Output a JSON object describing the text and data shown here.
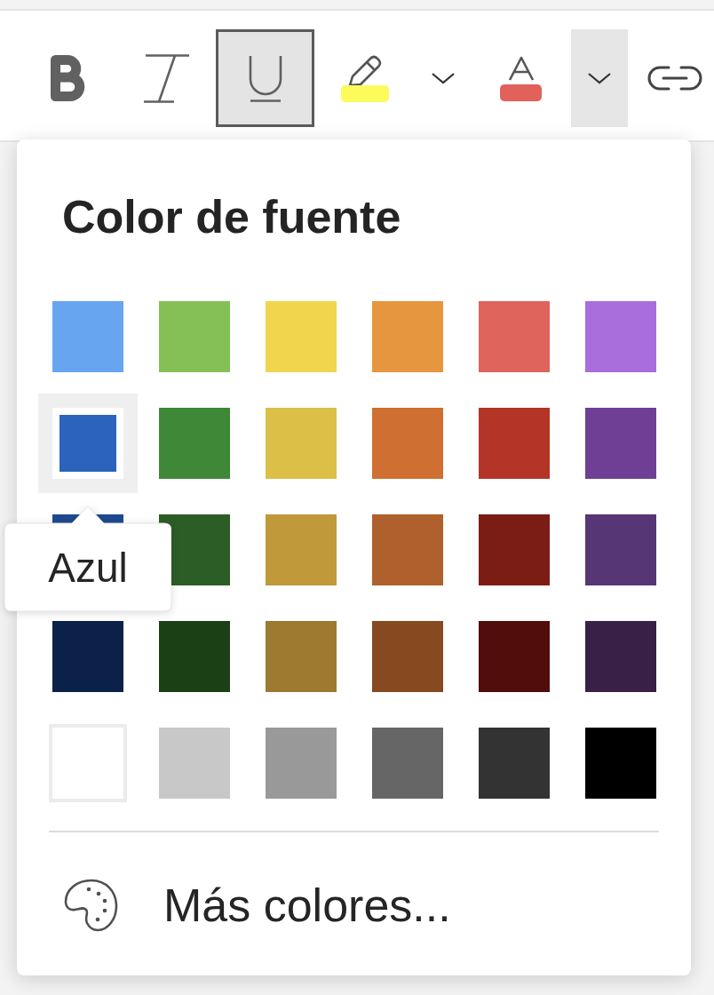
{
  "toolbar": {
    "format_buttons": [
      {
        "kind": "bold",
        "on": false
      },
      {
        "kind": "italic",
        "on": false
      },
      {
        "kind": "underline",
        "on": true
      }
    ],
    "color_buttons": [
      {
        "kind": "highlight",
        "color": "#fbfb5c",
        "menu_expanded": false
      },
      {
        "kind": "font-color",
        "color": "#e0625a",
        "menu_expanded": true
      }
    ]
  },
  "font_color_menu": {
    "title": "Color de fuente",
    "swatch_rows": [
      [
        {
          "color": "#68a5f1",
          "selected": false
        },
        {
          "color": "#85c057",
          "selected": false
        },
        {
          "color": "#f0d54d",
          "selected": false
        },
        {
          "color": "#e6963e",
          "selected": false
        },
        {
          "color": "#de645c",
          "selected": false
        },
        {
          "color": "#a96ddc",
          "selected": false
        }
      ],
      [
        {
          "color": "#2b63bd",
          "selected": true
        },
        {
          "color": "#3f8838",
          "selected": false
        },
        {
          "color": "#dbbf47",
          "selected": false
        },
        {
          "color": "#cf6f31",
          "selected": false
        },
        {
          "color": "#b43527",
          "selected": false
        },
        {
          "color": "#6f3f95",
          "selected": false
        }
      ],
      [
        {
          "color": "#1f4a8e",
          "selected": false
        },
        {
          "color": "#2d5d27",
          "selected": false
        },
        {
          "color": "#bf993a",
          "selected": false
        },
        {
          "color": "#af602c",
          "selected": false
        },
        {
          "color": "#7b1d15",
          "selected": false
        },
        {
          "color": "#573676",
          "selected": false
        }
      ],
      [
        {
          "color": "#0b214a",
          "selected": false
        },
        {
          "color": "#1c4016",
          "selected": false
        },
        {
          "color": "#9d7a30",
          "selected": false
        },
        {
          "color": "#864920",
          "selected": false
        },
        {
          "color": "#500d0b",
          "selected": false
        },
        {
          "color": "#392047",
          "selected": false
        }
      ],
      [
        {
          "color": "#ffffff",
          "selected": false
        },
        {
          "color": "#c8c8c8",
          "selected": false
        },
        {
          "color": "#999999",
          "selected": false
        },
        {
          "color": "#666666",
          "selected": false
        },
        {
          "color": "#333333",
          "selected": false
        },
        {
          "color": "#000000",
          "selected": false
        }
      ]
    ],
    "tooltip": "Azul",
    "more_colors": "Más colores..."
  }
}
